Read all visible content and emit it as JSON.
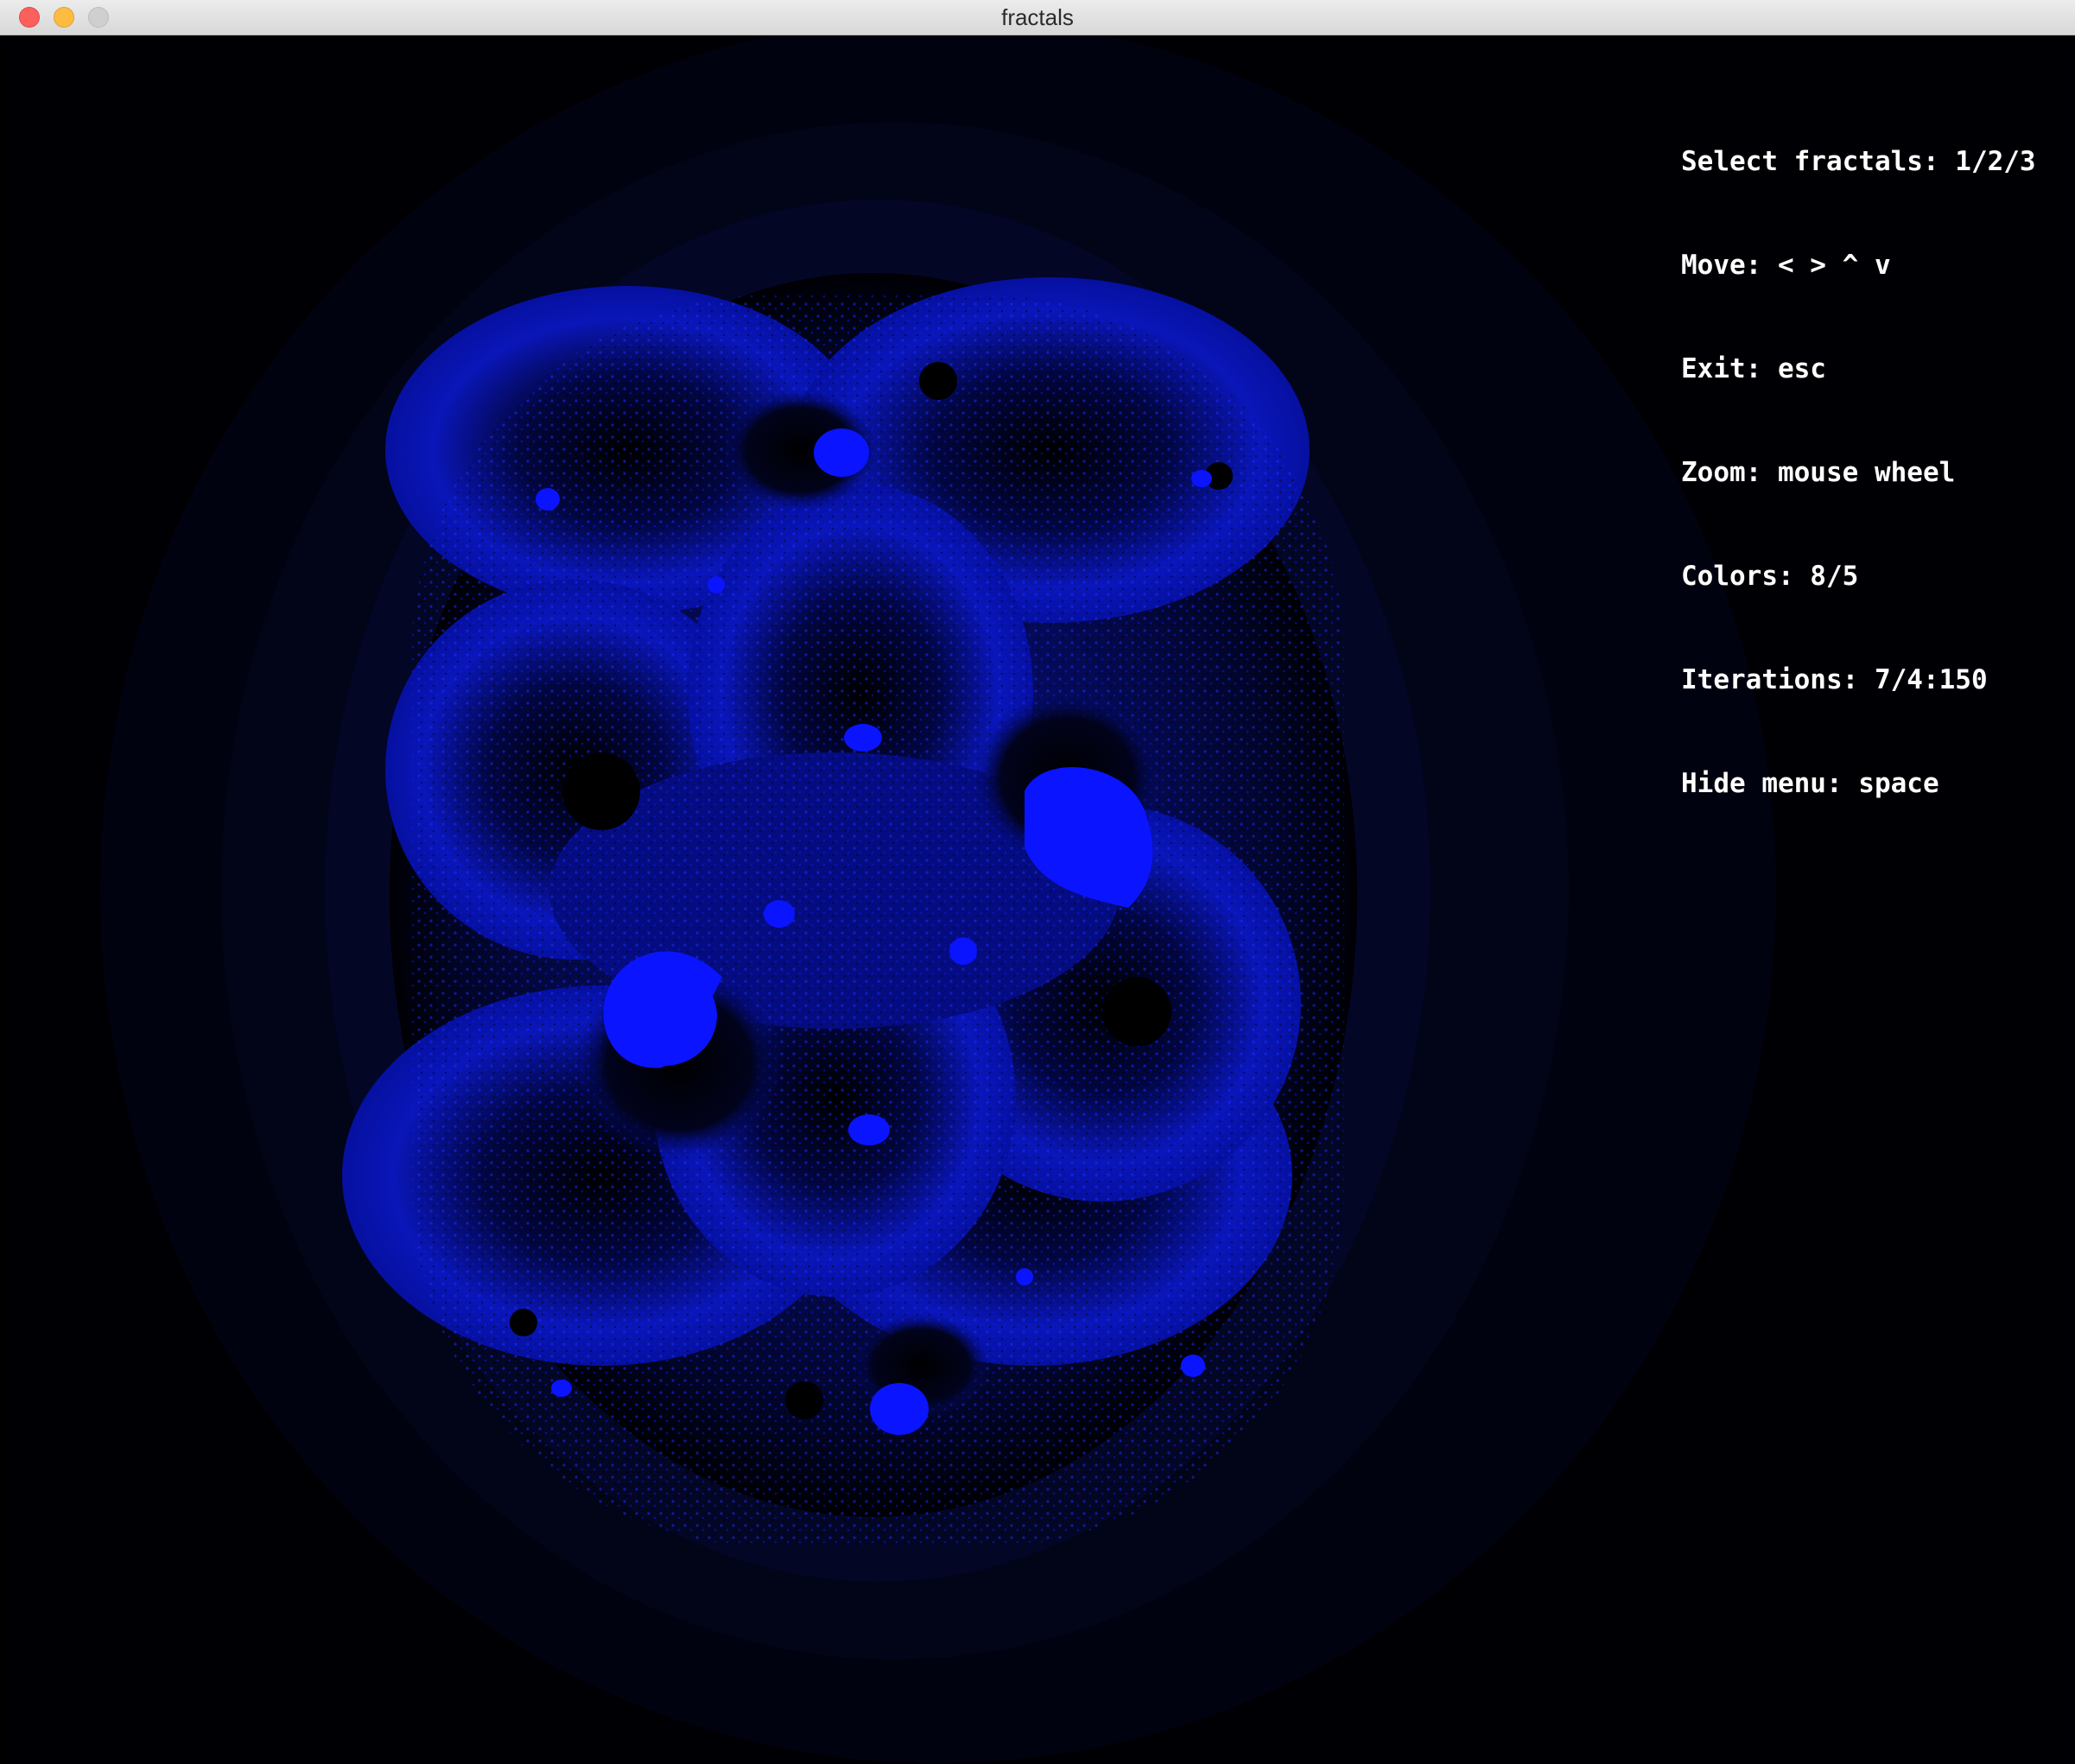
{
  "window": {
    "title": "fractals"
  },
  "menu": {
    "lines": [
      "Select fractals: 1/2/3",
      "Move: < > ^ v",
      "Exit: esc",
      "Zoom: mouse wheel",
      "Colors: 8/5",
      "Iterations: 7/4:150",
      "Hide menu: space"
    ]
  },
  "colors": {
    "background": "#000004",
    "fractal_accent": "#0a14ff",
    "menu_text": "#ffffff"
  }
}
